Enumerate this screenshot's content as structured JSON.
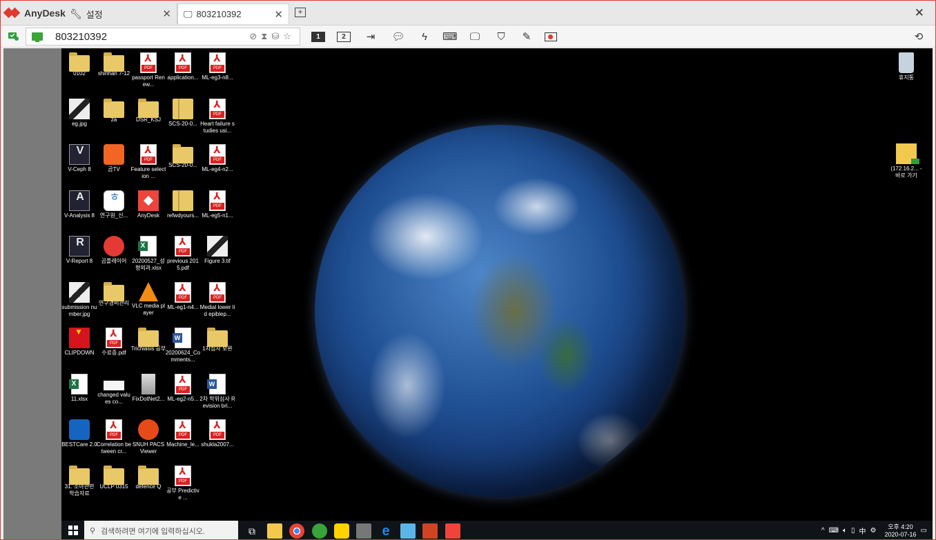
{
  "app": {
    "name": "AnyDesk"
  },
  "tabs": [
    {
      "label": "설정"
    },
    {
      "label": "803210392"
    }
  ],
  "toolbar": {
    "address_value": "803210392",
    "monitor_1": "1",
    "monitor_2": "2"
  },
  "desktop": {
    "left_icons": [
      {
        "label": "0102",
        "glyph": "folder"
      },
      {
        "label": "shinhan 7-12",
        "glyph": "folder"
      },
      {
        "label": "passport Renew...",
        "glyph": "pdf"
      },
      {
        "label": "application...",
        "glyph": "pdf"
      },
      {
        "label": "ML-eg3-n8...",
        "glyph": "pdf"
      },
      {
        "label": "eg.jpg",
        "glyph": "image"
      },
      {
        "label": "za",
        "glyph": "folder"
      },
      {
        "label": "DSR_KSJ",
        "glyph": "folder"
      },
      {
        "label": "SCS-20-0...",
        "glyph": "zip"
      },
      {
        "label": "Heart failure studies usi...",
        "glyph": "pdf"
      },
      {
        "label": "V-Ceph 8",
        "glyph": "app-dark",
        "text": "V"
      },
      {
        "label": "곰TV",
        "glyph": "gom"
      },
      {
        "label": "Feature selection ...",
        "glyph": "pdf"
      },
      {
        "label": "SCS-20-0...",
        "glyph": "folder"
      },
      {
        "label": "ML-eg4-n2...",
        "glyph": "pdf"
      },
      {
        "label": "V-Analysis 8",
        "glyph": "app-dark",
        "text": "A"
      },
      {
        "label": "연구원_신...",
        "glyph": "round-blue"
      },
      {
        "label": "AnyDesk",
        "glyph": "anydesk"
      },
      {
        "label": "refwdyours...",
        "glyph": "zip"
      },
      {
        "label": "ML-eg5-n1...",
        "glyph": "pdf"
      },
      {
        "label": "V-Report 8",
        "glyph": "app-dark",
        "text": "R"
      },
      {
        "label": "곰플레이어",
        "glyph": "gomplayer"
      },
      {
        "label": "20200527_성형외과.xlsx",
        "glyph": "excel"
      },
      {
        "label": "previous 2015.pdf",
        "glyph": "pdf"
      },
      {
        "label": "Figure 3.tif",
        "glyph": "image"
      },
      {
        "label": "submission number.jpg",
        "glyph": "image"
      },
      {
        "label": "연구경비관리",
        "glyph": "folder"
      },
      {
        "label": "VLC media player",
        "glyph": "vlc"
      },
      {
        "label": "ML-eg1-n4...",
        "glyph": "pdf"
      },
      {
        "label": "Medial lower lid epiblep...",
        "glyph": "pdf"
      },
      {
        "label": "CLIPDOWN",
        "glyph": "clip"
      },
      {
        "label": "수료증.pdf",
        "glyph": "pdf"
      },
      {
        "label": "Trichiasis 공부",
        "glyph": "folder"
      },
      {
        "label": "20200624_Comments...",
        "glyph": "word"
      },
      {
        "label": "1차심사 보완",
        "glyph": "folder"
      },
      {
        "label": "11.xlsx",
        "glyph": "excel"
      },
      {
        "label": "changed values co...",
        "glyph": "keyboard"
      },
      {
        "label": "FixDotNet2...",
        "glyph": "server"
      },
      {
        "label": "ML-eg2-n5...",
        "glyph": "pdf"
      },
      {
        "label": "2차 학위심사 Revision bri...",
        "glyph": "word"
      },
      {
        "label": "BESTCare 2.0",
        "glyph": "best"
      },
      {
        "label": "Correlation between cr...",
        "glyph": "pdf"
      },
      {
        "label": "SNUH PACS Viewer",
        "glyph": "pacs"
      },
      {
        "label": "Machine_le...",
        "glyph": "pdf"
      },
      {
        "label": "shukla2007...",
        "glyph": "pdf"
      },
      {
        "label": "31. 소아관련 학습자료",
        "glyph": "folder"
      },
      {
        "label": "UCLP 0315",
        "glyph": "folder"
      },
      {
        "label": "defence Q",
        "glyph": "folder"
      },
      {
        "label": "공부 Predictive ...",
        "glyph": "pdf"
      }
    ],
    "right_icons": [
      {
        "label": "휴지통",
        "glyph": "recycle"
      },
      {
        "label": "(172.16.2... - 바로 가기",
        "glyph": "network-folder"
      }
    ]
  },
  "taskbar": {
    "search_placeholder": "검색하려면 여기에 입력하십시오.",
    "tray_lang": "中",
    "clock_time": "오후 4:20",
    "clock_date": "2020-07-16"
  }
}
